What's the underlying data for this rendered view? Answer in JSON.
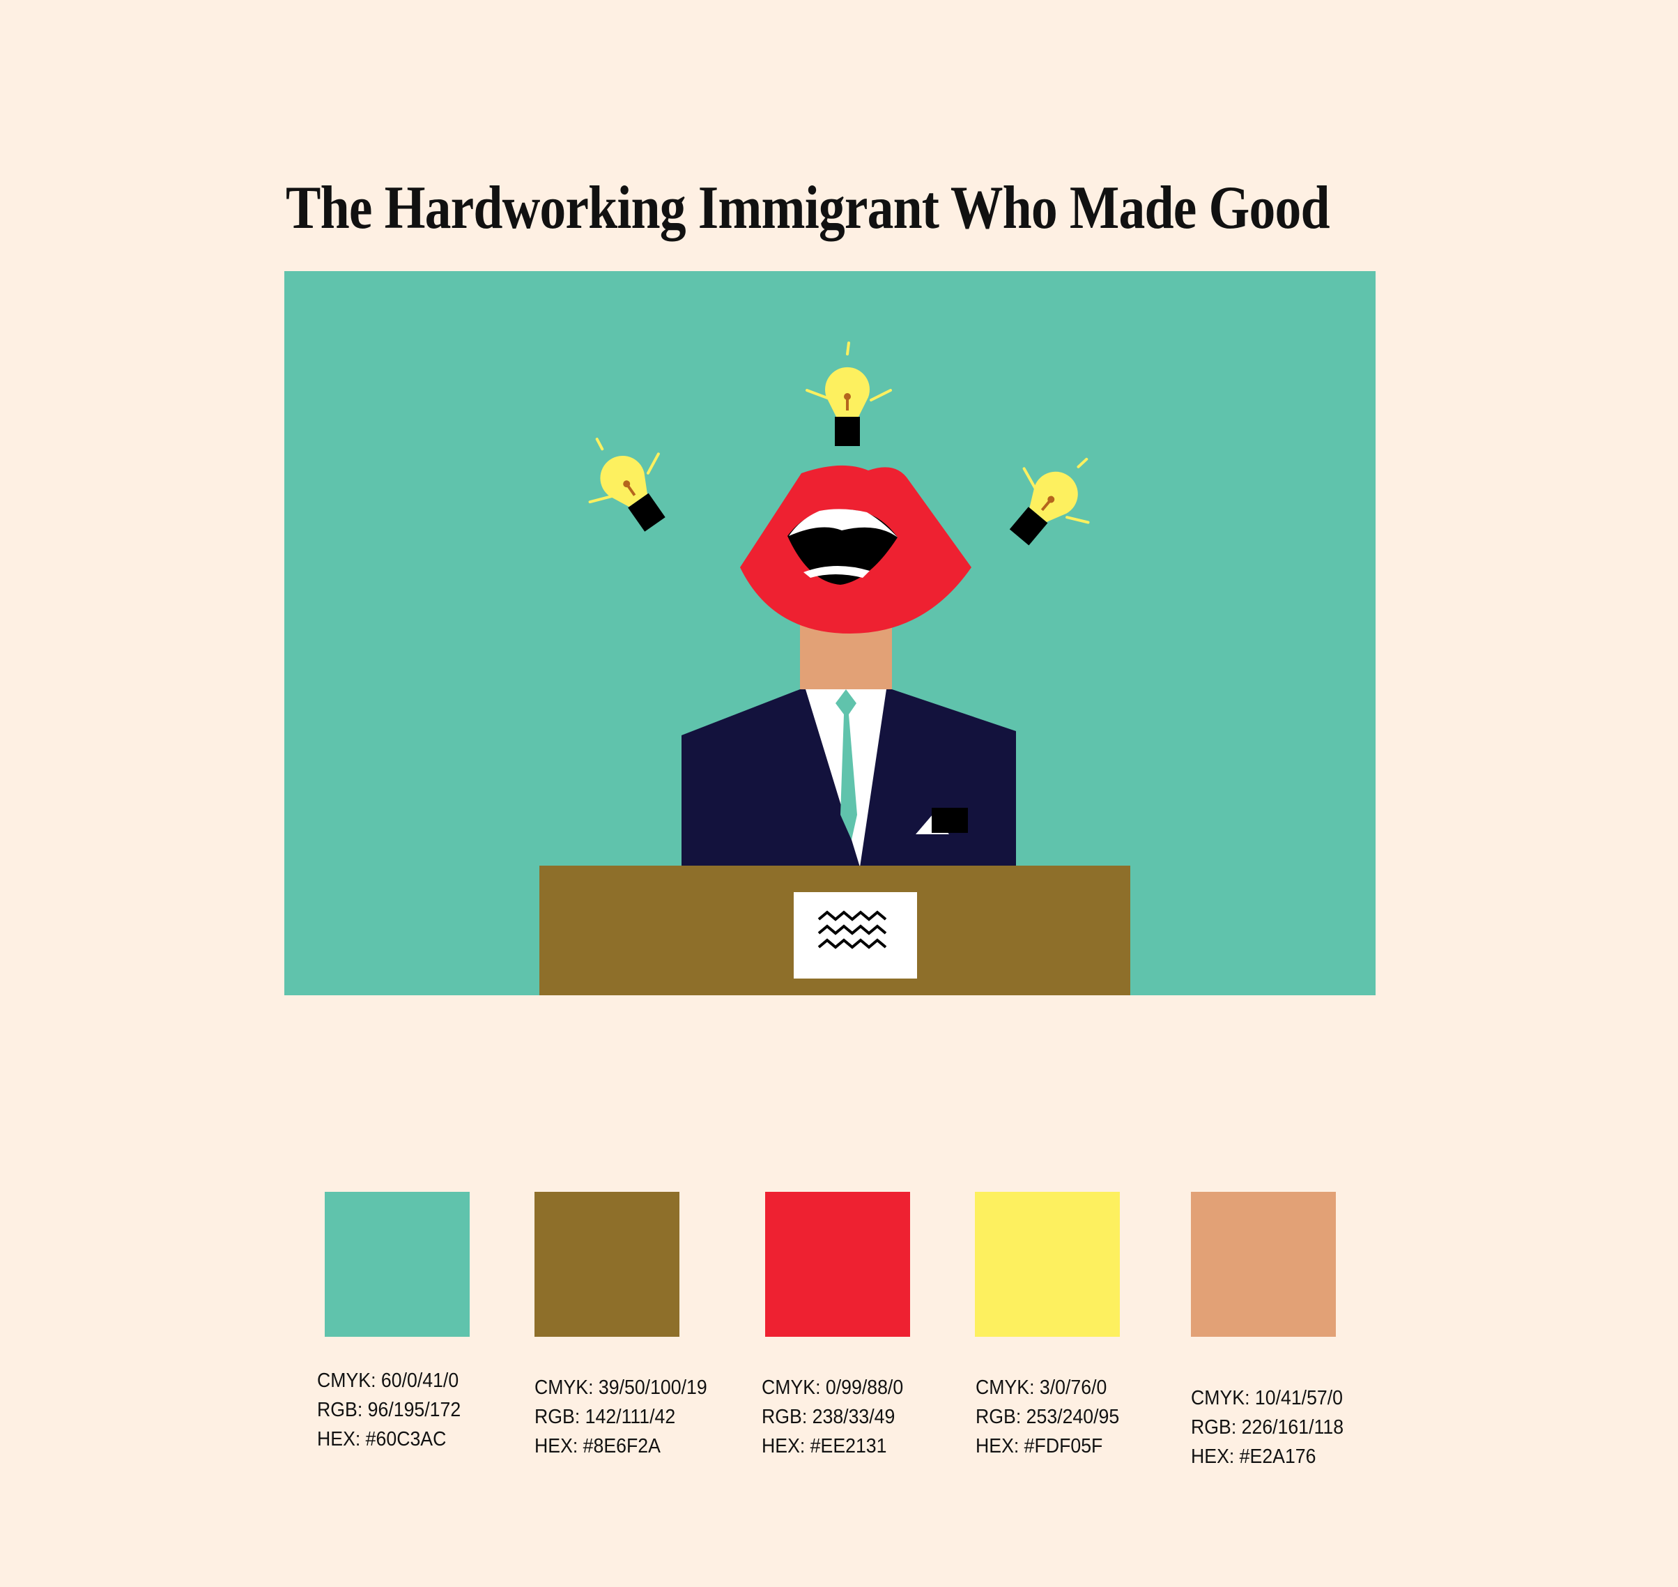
{
  "title": "The Hardworking Immigrant Who Made Good",
  "illustration": {
    "background_color": "#60C3AC",
    "elements": [
      "lightbulb-icon",
      "lips-icon",
      "suit-figure",
      "podium",
      "podium-sign"
    ]
  },
  "palette": [
    {
      "color": "#60C3AC",
      "cmyk": "CMYK: 60/0/41/0",
      "rgb": "RGB: 96/195/172",
      "hex": "HEX: #60C3AC"
    },
    {
      "color": "#8E6F2A",
      "cmyk": "CMYK: 39/50/100/19",
      "rgb": "RGB: 142/111/42",
      "hex": "HEX: #8E6F2A"
    },
    {
      "color": "#EE2131",
      "cmyk": "CMYK: 0/99/88/0",
      "rgb": "RGB: 238/33/49",
      "hex": "HEX: #EE2131"
    },
    {
      "color": "#FDF05F",
      "cmyk": "CMYK: 3/0/76/0",
      "rgb": "RGB: 253/240/95",
      "hex": "HEX: #FDF05F"
    },
    {
      "color": "#E2A176",
      "cmyk": "CMYK: 10/41/57/0",
      "rgb": "RGB: 226/161/118",
      "hex": "HEX: #E2A176"
    }
  ]
}
